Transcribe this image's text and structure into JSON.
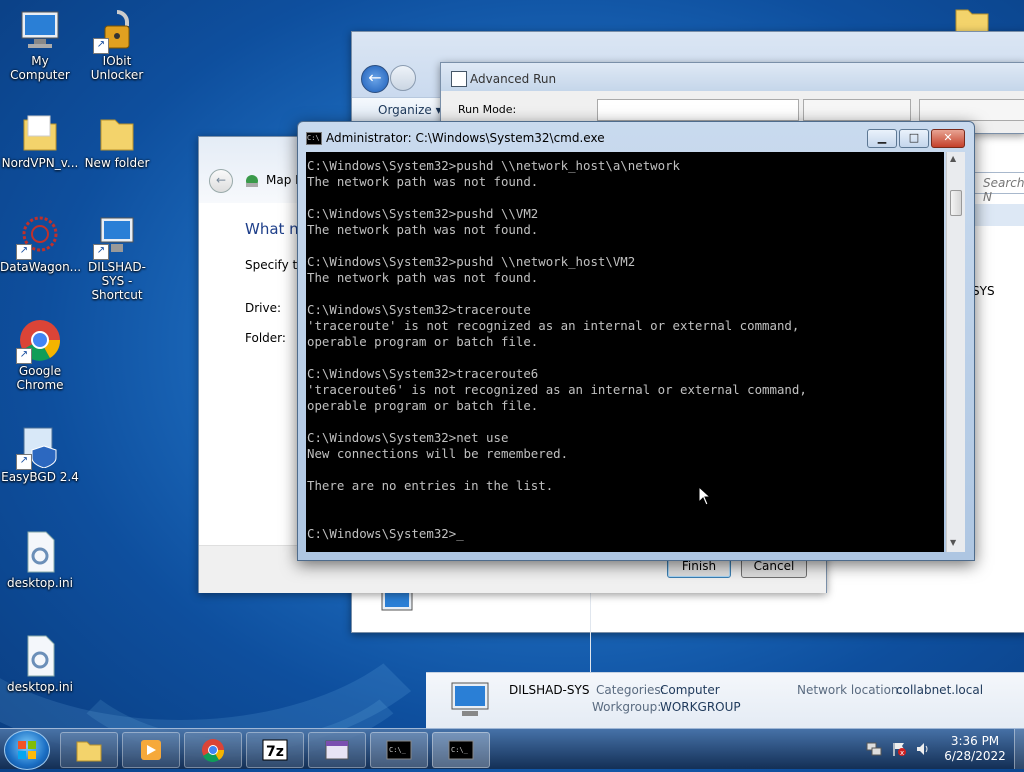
{
  "desktop": {
    "icons": [
      {
        "label": "My Computer"
      },
      {
        "label": "IObit Unlocker"
      },
      {
        "label": "NordVPN_v..."
      },
      {
        "label": "New folder"
      },
      {
        "label": "DataWagon..."
      },
      {
        "label": "DILSHAD-SYS - Shortcut"
      },
      {
        "label": "Google Chrome"
      },
      {
        "label": "EasyBGD 2.4"
      },
      {
        "label": "desktop.ini"
      },
      {
        "label": "desktop.ini"
      }
    ]
  },
  "explorer": {
    "organize": "Organize",
    "search_placeholder": "Search N",
    "sys_fragment": "SYS"
  },
  "advanced_run": {
    "title": "Advanced Run",
    "run_mode_label": "Run Mode:"
  },
  "map_drive": {
    "title_fragment": "Map N",
    "heading": "What ne",
    "specify": "Specify th",
    "drive_label": "Drive:",
    "folder_label": "Folder:",
    "finish": "Finish",
    "cancel": "Cancel"
  },
  "cmd": {
    "title": "Administrator: C:\\Windows\\System32\\cmd.exe",
    "lines": [
      "C:\\Windows\\System32>pushd \\\\network_host\\a\\network",
      "The network path was not found.",
      "",
      "C:\\Windows\\System32>pushd \\\\VM2",
      "The network path was not found.",
      "",
      "C:\\Windows\\System32>pushd \\\\network_host\\VM2",
      "The network path was not found.",
      "",
      "C:\\Windows\\System32>traceroute",
      "'traceroute' is not recognized as an internal or external command,",
      "operable program or batch file.",
      "",
      "C:\\Windows\\System32>traceroute6",
      "'traceroute6' is not recognized as an internal or external command,",
      "operable program or batch file.",
      "",
      "C:\\Windows\\System32>net use",
      "New connections will be remembered.",
      "",
      "There are no entries in the list.",
      "",
      "",
      "C:\\Windows\\System32>_"
    ]
  },
  "details": {
    "name": "DILSHAD-SYS",
    "categories_label": "Categories:",
    "categories_value": "Computer",
    "workgroup_label": "Workgroup:",
    "workgroup_value": "WORKGROUP",
    "network_label": "Network location:",
    "network_value": "collabnet.local"
  },
  "taskbar": {
    "time": "3:36 PM",
    "date": "6/28/2022"
  }
}
